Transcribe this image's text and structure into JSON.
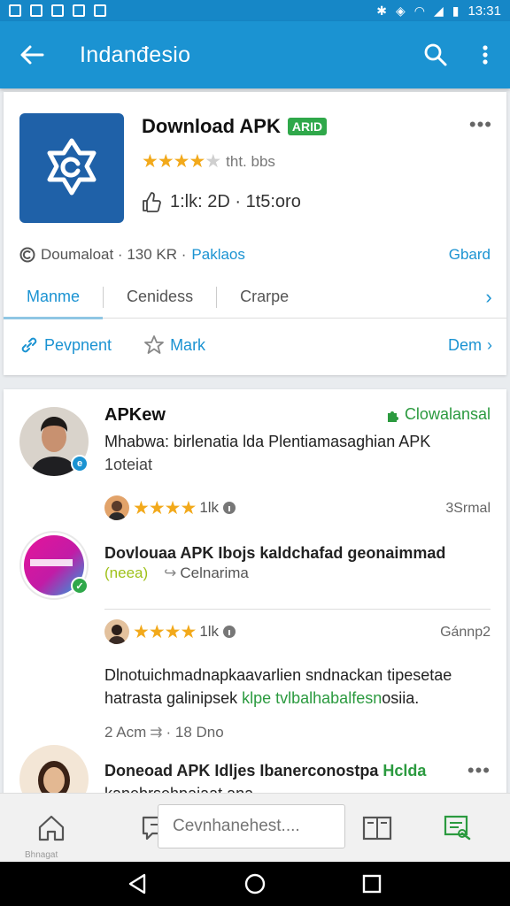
{
  "status_bar": {
    "time": "13:31"
  },
  "app_bar": {
    "title": "Indanđesio"
  },
  "app_card": {
    "title": "Download APK",
    "badge": "ARID",
    "rating_text": "tht. bbs",
    "rating_stars": 4,
    "size_text": "1:lk: 2D · 1t5:oro",
    "info_text": "Doumaloat · 130 KR ·",
    "info_link": "Paklaos",
    "info_right": "Gbard",
    "tabs": [
      "Manme",
      "Cenidess",
      "Crarpe"
    ],
    "active_tab": 0,
    "actions": {
      "share": "Pevpnent",
      "mark": "Mark",
      "more": "Dem"
    }
  },
  "feed": {
    "item1": {
      "name": "APKew",
      "tag": "Clowalansal",
      "text": "Mhabwa: birlenatia lda Plentiamasaghian APK",
      "text2": "1oteiat",
      "meta_count": "1lk",
      "meta_right": "3Srmal"
    },
    "item2": {
      "title": "Dovlouaa APK Ibojs kaldchafad geonaimmad",
      "tag": "(neea)",
      "meta": "Celnarima",
      "meta_count": "1lk",
      "meta_right": "Gánnp2",
      "body_line1": "Dlnotuichmadnapkaavarlien sndnackan tipesetae",
      "body_line2_start": "hatrasta galinipsek",
      "body_line2_highlight": "klpe tvlbalhabalfesn",
      "body_line2_end": "osiia.",
      "footer_a": "2 Acm",
      "footer_b": "· 18 Dno"
    },
    "item3": {
      "title_start": "Doneoad APK Idljes Ibanerconostpa",
      "title_highlight": "Hclda",
      "text": "kanebrsehpaiaat ana"
    }
  },
  "bottom_bar": {
    "search_placeholder": "Cevnhanehest....",
    "home_label": "Bhnagat"
  },
  "colors": {
    "primary": "#1b93d2",
    "accent_green": "#2fa84a",
    "star": "#f2a91b"
  },
  "icons": [
    "back-arrow-icon",
    "search-icon",
    "more-vert-icon",
    "home-icon",
    "chat-icon",
    "book-icon",
    "edit-icon"
  ]
}
